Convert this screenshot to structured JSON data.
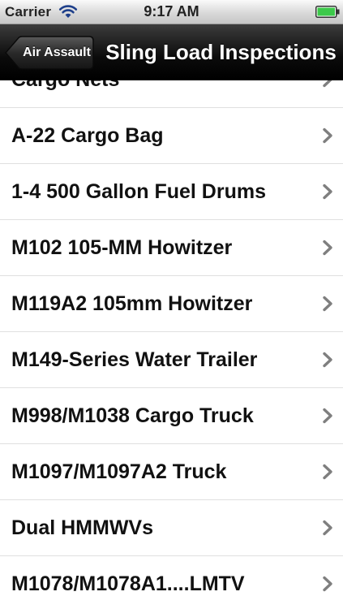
{
  "status_bar": {
    "carrier": "Carrier",
    "time": "9:17 AM",
    "battery_color": "#4cd964"
  },
  "nav_bar": {
    "back_label": "Air Assault",
    "title": "Sling Load Inspections"
  },
  "list": {
    "items": [
      {
        "label": "Cargo Nets"
      },
      {
        "label": "A-22 Cargo Bag"
      },
      {
        "label": "1-4 500 Gallon Fuel Drums"
      },
      {
        "label": "M102 105-MM Howitzer"
      },
      {
        "label": "M119A2 105mm Howitzer"
      },
      {
        "label": "M149-Series Water Trailer"
      },
      {
        "label": "M998/M1038 Cargo Truck"
      },
      {
        "label": "M1097/M1097A2 Truck"
      },
      {
        "label": "Dual HMMWVs"
      },
      {
        "label": "M1078/M1078A1....LMTV"
      }
    ],
    "chevron_icon": "chevron-right-icon"
  }
}
